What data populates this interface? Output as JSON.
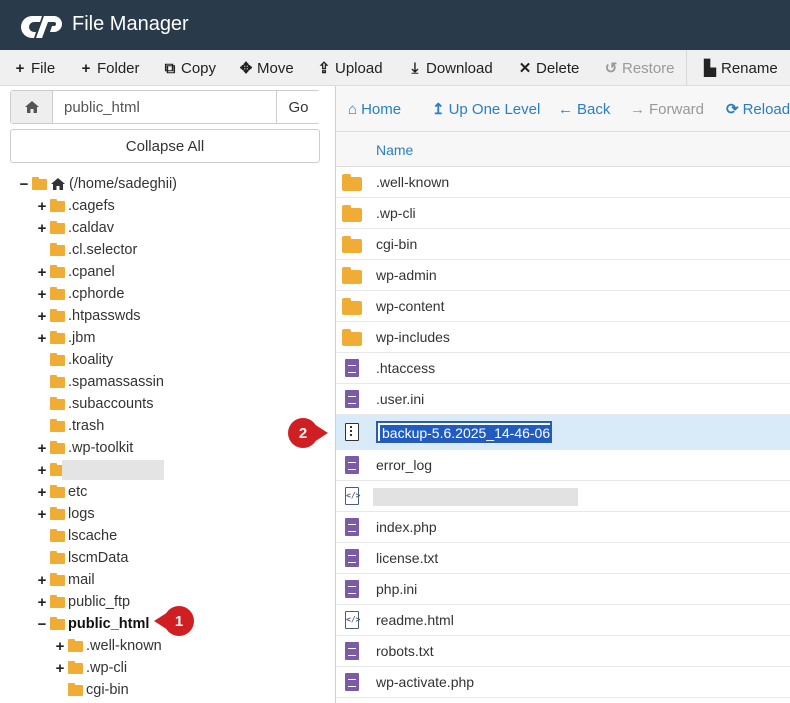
{
  "app": {
    "title": "File Manager"
  },
  "toolbar": {
    "file": "File",
    "folder": "Folder",
    "copy": "Copy",
    "move": "Move",
    "upload": "Upload",
    "download": "Download",
    "delete": "Delete",
    "restore": "Restore",
    "rename": "Rename"
  },
  "path": {
    "value": "public_html",
    "go": "Go",
    "collapse_all": "Collapse All"
  },
  "tree": [
    {
      "label": "(/home/sadeghii)"
    },
    {
      "label": ".cagefs"
    },
    {
      "label": ".caldav"
    },
    {
      "label": ".cl.selector"
    },
    {
      "label": ".cpanel"
    },
    {
      "label": ".cphorde"
    },
    {
      "label": ".htpasswds"
    },
    {
      "label": ".jbm"
    },
    {
      "label": ".koality"
    },
    {
      "label": ".spamassassin"
    },
    {
      "label": ".subaccounts"
    },
    {
      "label": ".trash"
    },
    {
      "label": ".wp-toolkit"
    },
    {
      "label": ""
    },
    {
      "label": "etc"
    },
    {
      "label": "logs"
    },
    {
      "label": "lscache"
    },
    {
      "label": "lscmData"
    },
    {
      "label": "mail"
    },
    {
      "label": "public_ftp"
    },
    {
      "label": "public_html"
    },
    {
      "label": ".well-known"
    },
    {
      "label": ".wp-cli"
    },
    {
      "label": "cgi-bin"
    }
  ],
  "nav": {
    "home": "Home",
    "up": "Up One Level",
    "back": "Back",
    "forward": "Forward",
    "reload": "Reload"
  },
  "list": {
    "column_name": "Name",
    "files": [
      {
        "name": ".well-known"
      },
      {
        "name": ".wp-cli"
      },
      {
        "name": "cgi-bin"
      },
      {
        "name": "wp-admin"
      },
      {
        "name": "wp-content"
      },
      {
        "name": "wp-includes"
      },
      {
        "name": ".htaccess"
      },
      {
        "name": ".user.ini"
      },
      {
        "name": "backup-5.6.2025_14-46-06"
      },
      {
        "name": "error_log"
      },
      {
        "name": ""
      },
      {
        "name": "index.php"
      },
      {
        "name": "license.txt"
      },
      {
        "name": "php.ini"
      },
      {
        "name": "readme.html"
      },
      {
        "name": "robots.txt"
      },
      {
        "name": "wp-activate.php"
      }
    ]
  },
  "badges": {
    "one": "1",
    "two": "2"
  },
  "colors": {
    "header": "#293a4a",
    "accent": "#2a7ec2",
    "folder": "#f0ad35",
    "badge": "#d01f22",
    "selected": "#d9ebf8"
  }
}
